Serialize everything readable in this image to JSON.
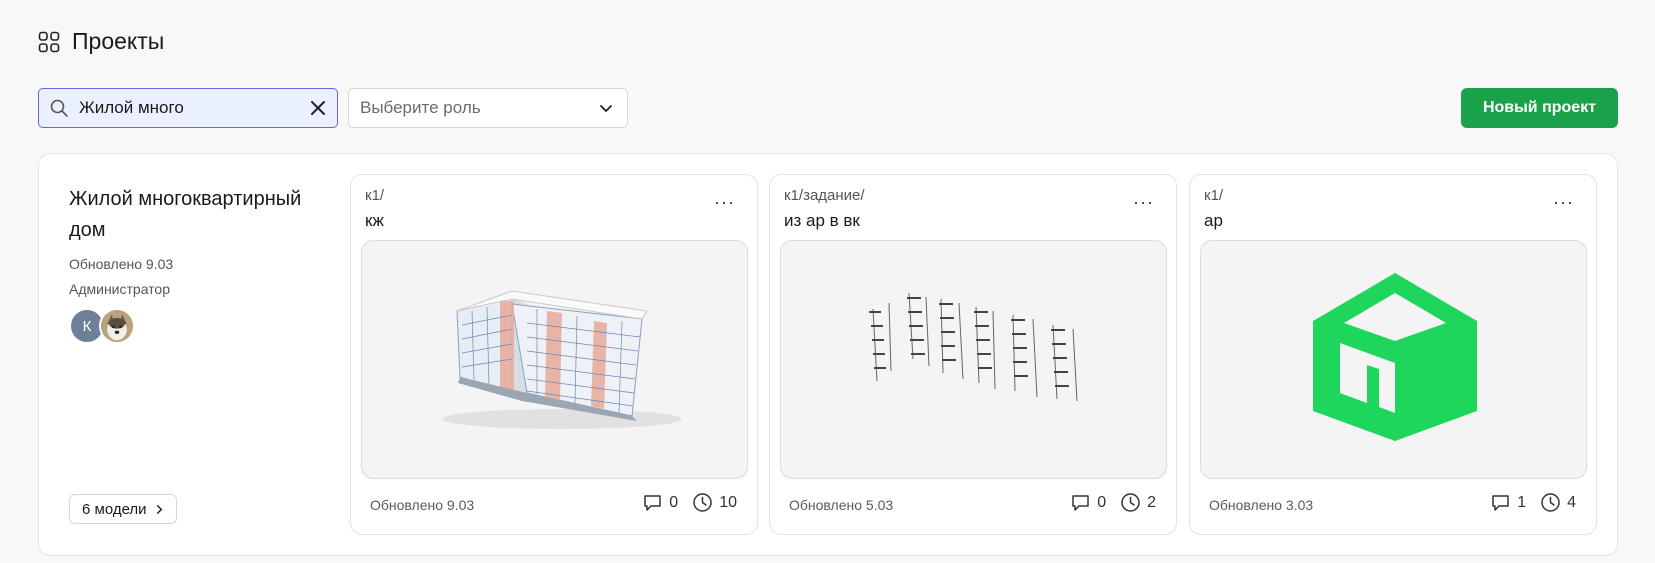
{
  "header": {
    "title": "Проекты",
    "icon": "grid-icon"
  },
  "toolbar": {
    "search_value": "Жилой много",
    "role_placeholder": "Выберите роль",
    "new_project_label": "Новый проект"
  },
  "colors": {
    "primary": "#1aa24a",
    "search_bg": "#eaf0fd",
    "search_border": "#5b6be5",
    "logo_green": "#1fd65c"
  },
  "project": {
    "name": "Жилой многоквартирный дом",
    "updated": "Обновлено 9.03",
    "role": "Администратор",
    "avatars": [
      {
        "initial": "К"
      },
      {
        "initial": ""
      }
    ],
    "models_button": "6 модели"
  },
  "models": [
    {
      "path": "к1/",
      "name": "кж",
      "updated": "Обновлено 9.03",
      "comments": "0",
      "versions": "10"
    },
    {
      "path": "к1/задание/",
      "name": "из ар в вк",
      "updated": "Обновлено 5.03",
      "comments": "0",
      "versions": "2"
    },
    {
      "path": "к1/",
      "name": "ар",
      "updated": "Обновлено 3.03",
      "comments": "1",
      "versions": "4"
    }
  ]
}
